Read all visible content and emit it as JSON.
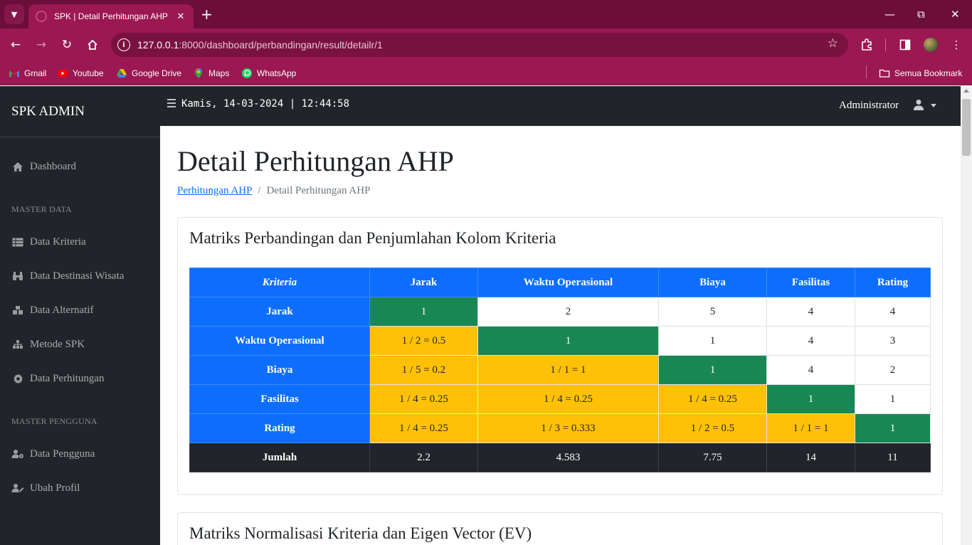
{
  "browser": {
    "tab_title": "SPK | Detail Perhitungan AHP",
    "url_host": "127.0.0.1",
    "url_path": ":8000/dashboard/perbandingan/result/detailr/1",
    "bookmarks": [
      "Gmail",
      "Youtube",
      "Google Drive",
      "Maps",
      "WhatsApp"
    ],
    "all_bookmarks": "Semua Bookmark"
  },
  "sidebar": {
    "brand": "SPK ADMIN",
    "dashboard": "Dashboard",
    "heading_master_data": "MASTER DATA",
    "master_items": [
      "Data Kriteria",
      "Data Destinasi Wisata",
      "Data Alternatif",
      "Metode SPK",
      "Data Perhitungan"
    ],
    "heading_master_pengguna": "MASTER PENGGUNA",
    "user_items": [
      "Data Pengguna",
      "Ubah Profil"
    ]
  },
  "topbar": {
    "clock": "Kamis, 14-03-2024 | 12:44:58",
    "user_name": "Administrator"
  },
  "page": {
    "title": "Detail Perhitungan AHP",
    "breadcrumb_link": "Perhitungan AHP",
    "breadcrumb_current": "Detail Perhitungan AHP"
  },
  "card1": {
    "title": "Matriks Perbandingan dan Penjumlahan Kolom Kriteria",
    "header": [
      "Kriteria",
      "Jarak",
      "Waktu Operasional",
      "Biaya",
      "Fasilitas",
      "Rating"
    ],
    "rows": [
      {
        "label": "Jarak",
        "cells": [
          "1",
          "2",
          "5",
          "4",
          "4"
        ]
      },
      {
        "label": "Waktu Operasional",
        "cells": [
          "1 / 2 = 0.5",
          "1",
          "1",
          "4",
          "3"
        ]
      },
      {
        "label": "Biaya",
        "cells": [
          "1 / 5 = 0.2",
          "1 / 1 = 1",
          "1",
          "4",
          "2"
        ]
      },
      {
        "label": "Fasilitas",
        "cells": [
          "1 / 4 = 0.25",
          "1 / 4 = 0.25",
          "1 / 4 = 0.25",
          "1",
          "1"
        ]
      },
      {
        "label": "Rating",
        "cells": [
          "1 / 4 = 0.25",
          "1 / 3 = 0.333",
          "1 / 2 = 0.5",
          "1 / 1 = 1",
          "1"
        ]
      }
    ],
    "sum_label": "Jumlah",
    "sums": [
      "2.2",
      "4.583",
      "7.75",
      "14",
      "11"
    ]
  },
  "card2": {
    "title": "Matriks Normalisasi Kriteria dan Eigen Vector (EV)"
  },
  "colors": {
    "header_blue": "#0d6efd",
    "diagonal_green": "#198754",
    "reciprocal_yellow": "#ffc107",
    "dark": "#212529",
    "browser_accent": "#9b1852"
  }
}
